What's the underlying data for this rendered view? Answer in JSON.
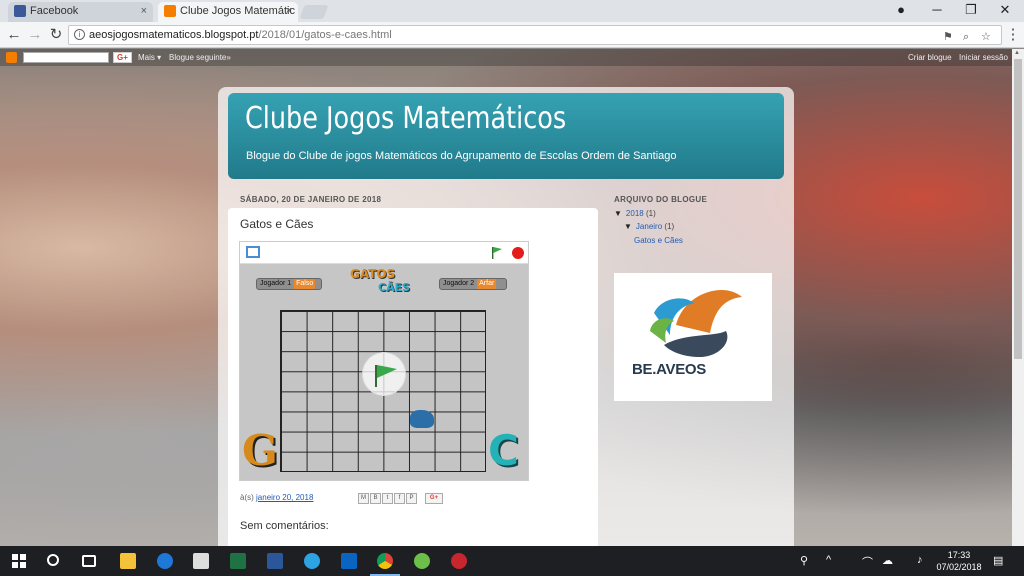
{
  "browser": {
    "tabs": [
      {
        "label": "Facebook",
        "favicon_color": "#3b5998"
      },
      {
        "label": "Clube Jogos Matemátic",
        "favicon_color": "#f57d00"
      }
    ],
    "close_glyph": "×",
    "window_controls": {
      "minimize": "─",
      "maximize": "❐",
      "close": "✕"
    },
    "url_host": "aeosjogosmatematicos.blogspot.pt",
    "url_path": "/2018/01/gatos-e-caes.html",
    "nav": {
      "back": "←",
      "forward": "→",
      "reload": "↻"
    }
  },
  "blogger_bar": {
    "gplus": "G+",
    "more": "Mais ▾",
    "next_blog": "Blogue seguinte»",
    "create_blog": "Criar blogue",
    "sign_in": "Iniciar sessão"
  },
  "blog": {
    "title": "Clube Jogos Matemáticos",
    "description": "Blogue do Clube de jogos Matemáticos do Agrupamento de Escolas Ordem de Santiago"
  },
  "post": {
    "date_header": "SÁBADO, 20 DE JANEIRO DE 2018",
    "title": "Gatos e Cães",
    "posted_prefix": "à(s)",
    "posted_link": "janeiro 20, 2018",
    "share_icons": [
      "M",
      "B",
      "t",
      "f",
      "P"
    ],
    "gplus": "G+",
    "comments": "Sem comentários:"
  },
  "game": {
    "player1": "Jogador 1",
    "player1_value": "Falso",
    "player2": "Jogador 2",
    "player2_value": "Arfar",
    "title_top": "GATOS",
    "title_bottom": "CÃES",
    "letter_g": "G",
    "letter_c": "C",
    "accent": "#d68a1e",
    "accent2": "#25b2b6"
  },
  "sidebar": {
    "archive_title": "ARQUIVO DO BLOGUE",
    "year": "2018",
    "year_count": "(1)",
    "month": "Janeiro",
    "month_count": "(1)",
    "post_link": "Gatos e Cães",
    "logo_text": "BE.AVEOS"
  },
  "taskbar": {
    "time": "17:33",
    "date": "07/02/2018"
  }
}
